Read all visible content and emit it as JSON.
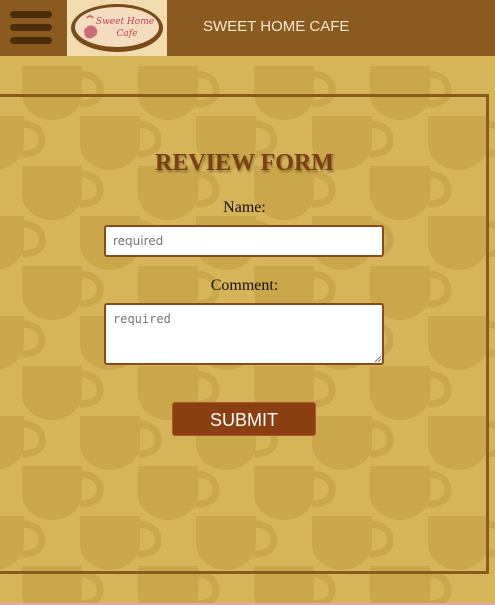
{
  "header": {
    "title": "SWEET HOME CAFE",
    "menu_icon": "hamburger-menu-icon",
    "logo_text_line1": "Sweet Home",
    "logo_text_line2": "Cafe",
    "background_color": "#8b5a1e"
  },
  "form": {
    "title": "REVIEW FORM",
    "name_label": "Name:",
    "name_placeholder": "required",
    "comment_label": "Comment:",
    "comment_placeholder": "required",
    "submit_label": "SUBMIT"
  },
  "colors": {
    "page_background": "#d6b45a",
    "pattern_cup": "#c9a44b",
    "accent": "#8b3f10"
  }
}
